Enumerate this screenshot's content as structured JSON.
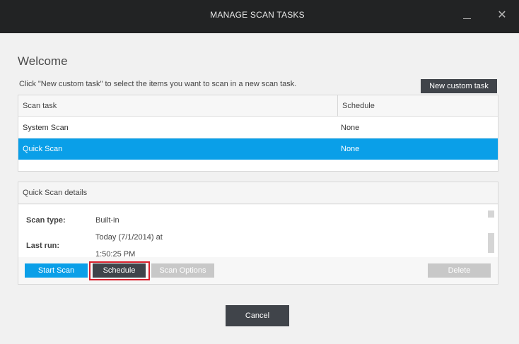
{
  "window": {
    "title": "MANAGE SCAN TASKS",
    "minimize_icon": "minimize-icon",
    "close_icon": "close-icon",
    "close_glyph": "✕"
  },
  "main": {
    "heading": "Welcome",
    "hint": "Click \"New custom task\" to select the items you want to scan in a new scan task.",
    "new_task_label": "New custom task"
  },
  "task_table": {
    "columns": [
      "Scan task",
      "Schedule"
    ],
    "rows": [
      {
        "task": "System Scan",
        "schedule": "None",
        "selected": false
      },
      {
        "task": "Quick Scan",
        "schedule": "None",
        "selected": true
      }
    ]
  },
  "details": {
    "heading": "Quick Scan details",
    "scan_type_label": "Scan type:",
    "scan_type_value": "Built-in",
    "last_run_label": "Last run:",
    "last_run_line1": "Today (7/1/2014) at",
    "last_run_line2": "1:50:25 PM"
  },
  "actions": {
    "start_scan": "Start Scan",
    "schedule": "Schedule",
    "scan_options": "Scan Options",
    "delete": "Delete",
    "cancel": "Cancel"
  },
  "colors": {
    "accent": "#0a9fe8",
    "dark_button": "#40444a",
    "disabled_button": "#c8c8c8",
    "highlight_outline": "#d81e2a",
    "titlebar": "#222324"
  }
}
